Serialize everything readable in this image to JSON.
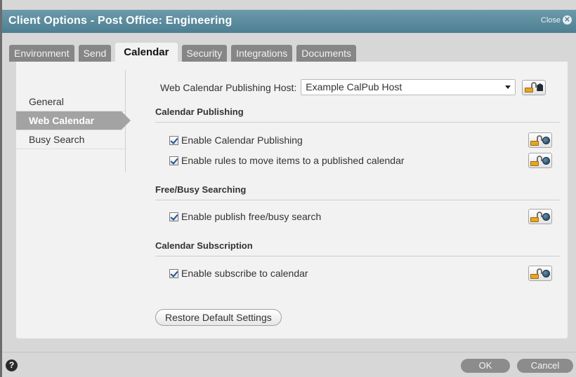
{
  "window": {
    "title": "Client Options - Post Office: Engineering",
    "close_label": "Close",
    "close_icon": "close-icon"
  },
  "tabs": [
    {
      "label": "Environment",
      "active": false
    },
    {
      "label": "Send",
      "active": false
    },
    {
      "label": "Calendar",
      "active": true
    },
    {
      "label": "Security",
      "active": false
    },
    {
      "label": "Integrations",
      "active": false
    },
    {
      "label": "Documents",
      "active": false
    }
  ],
  "sidebar": {
    "items": [
      {
        "label": "General",
        "active": false
      },
      {
        "label": "Web Calendar",
        "active": true
      },
      {
        "label": "Busy Search",
        "active": false
      }
    ]
  },
  "content": {
    "host_label": "Web Calendar Publishing Host:",
    "host_value": "Example CalPub Host",
    "sections": [
      {
        "title": "Calendar Publishing",
        "options": [
          {
            "label": "Enable Calendar Publishing",
            "checked": true
          },
          {
            "label": "Enable rules to move items to a published calendar",
            "checked": true
          }
        ]
      },
      {
        "title": "Free/Busy Searching",
        "options": [
          {
            "label": "Enable publish free/busy search",
            "checked": true
          }
        ]
      },
      {
        "title": "Calendar Subscription",
        "options": [
          {
            "label": "Enable subscribe to calendar",
            "checked": true
          }
        ]
      }
    ],
    "restore_label": "Restore Default Settings"
  },
  "footer": {
    "help_label": "?",
    "ok_label": "OK",
    "cancel_label": "Cancel"
  },
  "colors": {
    "titlebar": "#4d7f92",
    "tab_inactive": "#868686",
    "sidebar_active": "#a3a3a3",
    "button_gray": "#8c8c8c"
  }
}
